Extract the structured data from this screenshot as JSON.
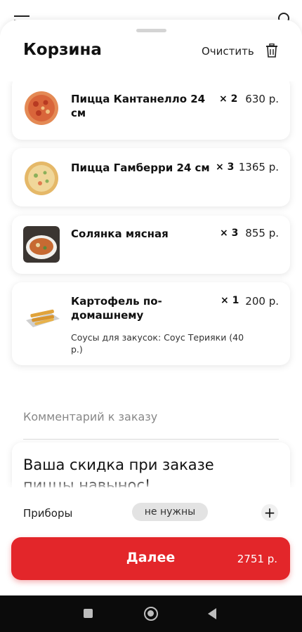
{
  "header": {
    "title": "Корзина",
    "clear_label": "Очистить"
  },
  "items": [
    {
      "name": "Пицца Кантанелло 24 см",
      "qty": "× 2",
      "price": "630 р.",
      "note": ""
    },
    {
      "name": "Пицца Гамберри 24 см",
      "qty": "× 3",
      "price": "1365 р.",
      "note": ""
    },
    {
      "name": "Солянка мясная",
      "qty": "× 3",
      "price": "855 р.",
      "note": ""
    },
    {
      "name": "Картофель по-домашнему",
      "qty": "× 1",
      "price": "200 р.",
      "note": "Соусы для закусок: Соус Терияки (40 р.)"
    }
  ],
  "comment": {
    "placeholder": "Комментарий к заказу"
  },
  "promo": {
    "text": "Ваша скидка при заказе пиццы навынос!"
  },
  "footer": {
    "cutlery_label": "Приборы",
    "cutlery_value": "не нужны",
    "plus": "+",
    "next_label": "Далее",
    "total": "2751 р."
  },
  "colors": {
    "accent": "#e3262a",
    "chip": "#e3e3e3"
  },
  "icons": [
    "menu-icon",
    "location-pin-icon",
    "trash-icon",
    "plus-icon",
    "recents-icon",
    "home-icon",
    "back-icon"
  ]
}
